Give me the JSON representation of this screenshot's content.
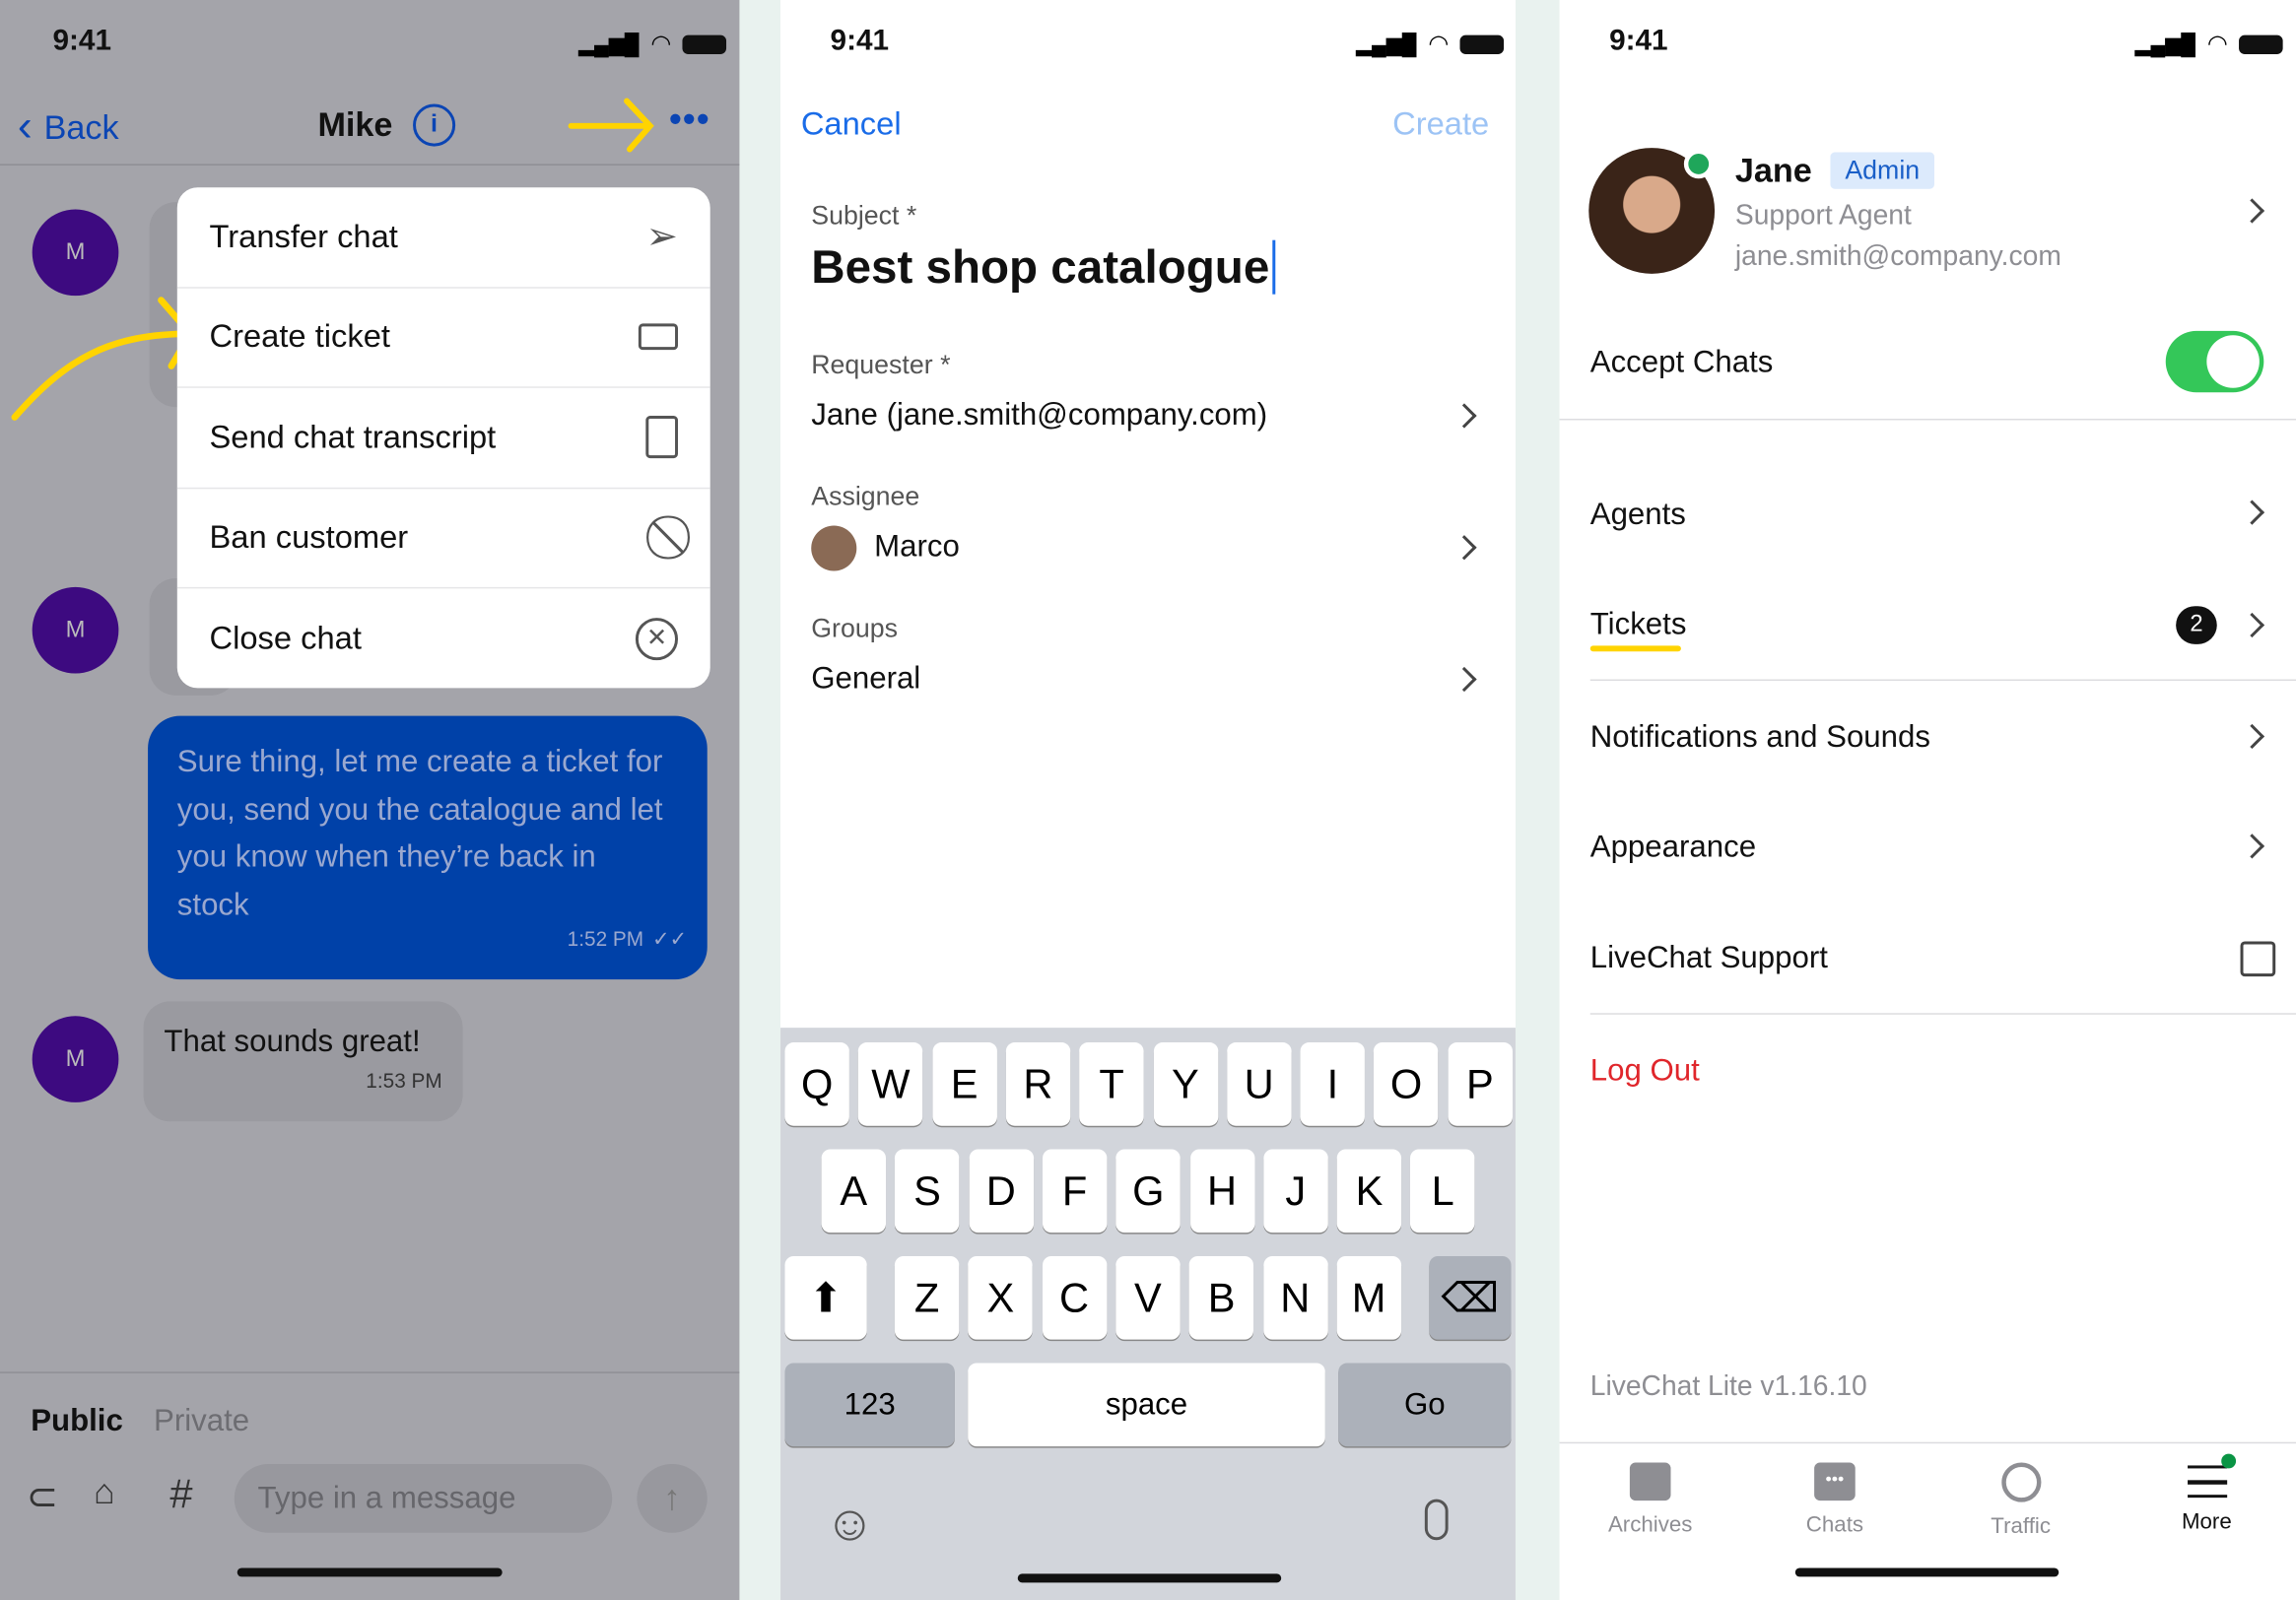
{
  "status": {
    "time": "9:41"
  },
  "chat": {
    "back_label": "Back",
    "contact_name": "Mike",
    "avatar_initial": "M",
    "menu": [
      {
        "label": "Transfer chat",
        "icon": "send-icon"
      },
      {
        "label": "Create ticket",
        "icon": "ticket-icon"
      },
      {
        "label": "Send chat transcript",
        "icon": "document-icon"
      },
      {
        "label": "Ban customer",
        "icon": "ban-icon"
      },
      {
        "label": "Close chat",
        "icon": "close-circle-icon"
      }
    ],
    "messages": [
      {
        "from": "agent",
        "text": "Sure thing, let me create a ticket for you, send you the catalogue and let you know when they’re back in stock",
        "time": "1:52 PM"
      },
      {
        "from": "customer",
        "text": "That sounds great!",
        "time": "1:53 PM"
      }
    ],
    "mode_tabs": [
      "Public",
      "Private"
    ],
    "input_placeholder": "Type in a message",
    "hash": "#"
  },
  "ticket": {
    "cancel": "Cancel",
    "create": "Create",
    "subject_label": "Subject *",
    "subject_value": "Best shop catalogue",
    "requester_label": "Requester *",
    "requester_value": "Jane (jane.smith@company.com)",
    "assignee_label": "Assignee",
    "assignee_value": "Marco",
    "groups_label": "Groups",
    "groups_value": "General",
    "keyboard": {
      "row1": [
        "Q",
        "W",
        "E",
        "R",
        "T",
        "Y",
        "U",
        "I",
        "O",
        "P"
      ],
      "row2": [
        "A",
        "S",
        "D",
        "F",
        "G",
        "H",
        "J",
        "K",
        "L"
      ],
      "row3": [
        "Z",
        "X",
        "C",
        "V",
        "B",
        "N",
        "M"
      ],
      "numbers": "123",
      "space": "space",
      "go": "Go"
    }
  },
  "settings": {
    "name": "Jane",
    "role_badge": "Admin",
    "role": "Support Agent",
    "email": "jane.smith@company.com",
    "accept_chats": "Accept Chats",
    "accept_chats_on": true,
    "items": [
      {
        "label": "Agents"
      },
      {
        "label": "Tickets",
        "badge": "2"
      },
      {
        "label": "Notifications and Sounds"
      },
      {
        "label": "Appearance"
      },
      {
        "label": "LiveChat Support"
      }
    ],
    "logout": "Log Out",
    "version": "LiveChat Lite v1.16.10",
    "tabs": [
      {
        "label": "Archives",
        "icon": "inbox-icon"
      },
      {
        "label": "Chats",
        "icon": "chat-bubble-icon"
      },
      {
        "label": "Traffic",
        "icon": "target-icon"
      },
      {
        "label": "More",
        "icon": "menu-icon",
        "active": true
      }
    ]
  },
  "colors": {
    "accent": "#0041a8",
    "link": "#1a6ce8",
    "toggle": "#34c759",
    "logout": "#e0262b",
    "highlight": "#ffd400"
  }
}
